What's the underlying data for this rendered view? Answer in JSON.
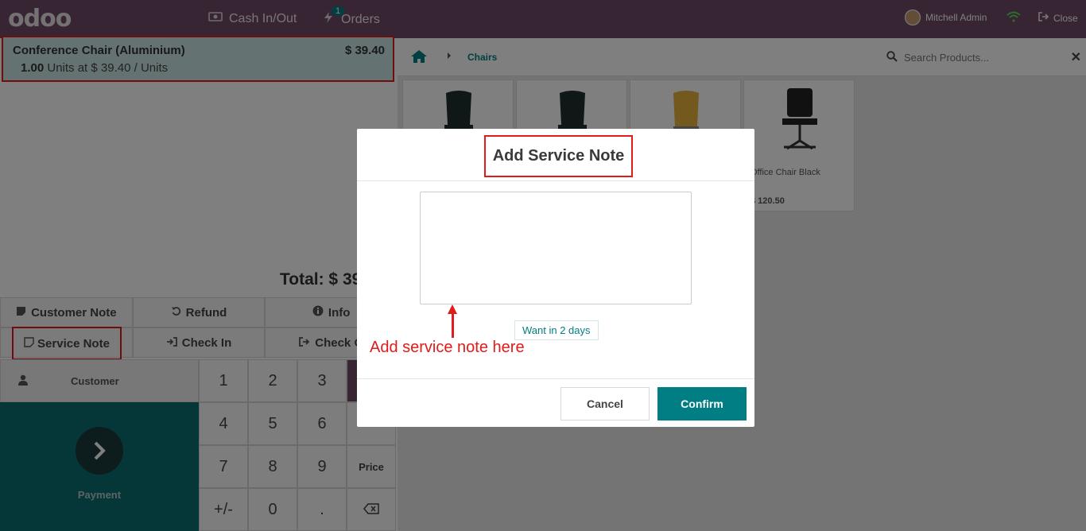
{
  "topbar": {
    "logo": "odoo",
    "cash_label": "Cash In/Out",
    "orders_label": "Orders",
    "orders_badge": "1",
    "user_name": "Mitchell Admin",
    "close_label": "Close"
  },
  "order": {
    "line": {
      "name": "Conference Chair (Aluminium)",
      "price": "$ 39.40",
      "qty": "1.00",
      "unit_text": "Units at $ 39.40 / Units"
    },
    "total": "Total: $ 39"
  },
  "controls": {
    "customer_note": "Customer Note",
    "refund": "Refund",
    "info": "Info",
    "service_note": "Service Note",
    "check_in": "Check In",
    "check_out": "Check O"
  },
  "pad": {
    "customer": "Customer",
    "payment": "Payment",
    "keys": [
      "1",
      "2",
      "3",
      "4",
      "5",
      "6",
      "7",
      "8",
      "9",
      "+/-",
      "0",
      "."
    ],
    "price_mode": "Price"
  },
  "products": {
    "breadcrumb": "Chairs",
    "search_placeholder": "Search Products...",
    "items": [
      {
        "name": "",
        "price": ""
      },
      {
        "name": "",
        "price": ""
      },
      {
        "name": "",
        "price": ""
      },
      {
        "name": "Office Chair Black",
        "price": "$ 120.50"
      }
    ]
  },
  "modal": {
    "title": "Add Service Note",
    "note_value": "",
    "suggestion": "Want in 2 days",
    "annotation": "Add service note here",
    "cancel": "Cancel",
    "confirm": "Confirm"
  },
  "colors": {
    "brand": "#714b67",
    "accent": "#017e84",
    "highlight": "#e01b1b"
  }
}
